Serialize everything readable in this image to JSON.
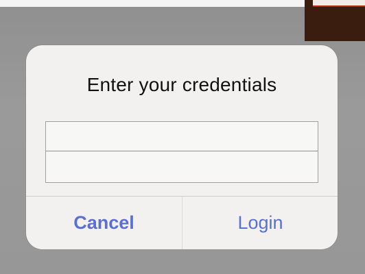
{
  "dialog": {
    "title": "Enter your credentials",
    "fields": [
      {
        "value": "",
        "placeholder": ""
      },
      {
        "value": "",
        "placeholder": ""
      }
    ],
    "buttons": {
      "cancel": "Cancel",
      "login": "Login"
    }
  },
  "colors": {
    "accent": "#5a6fd1",
    "dialog_bg": "#f2f1f0",
    "backdrop": "#969696"
  }
}
